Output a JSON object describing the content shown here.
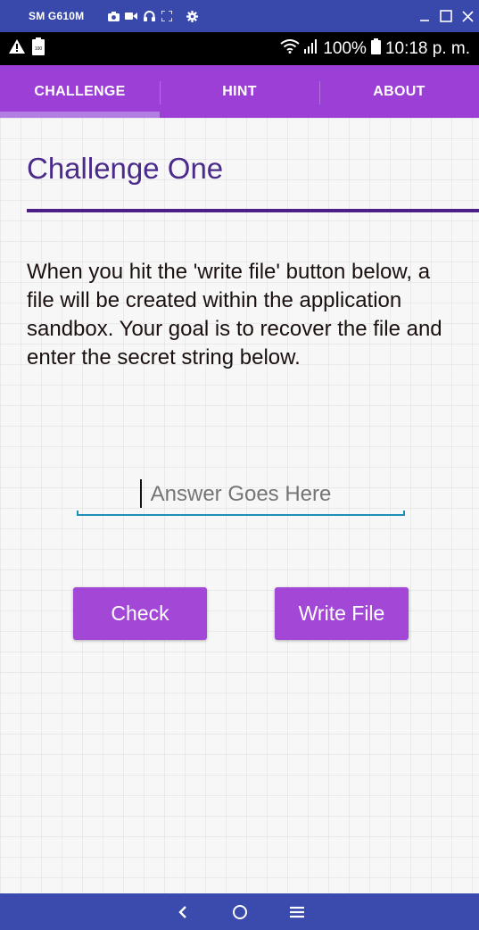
{
  "window": {
    "title": "SM G610M",
    "tools": [
      "camera-icon",
      "video-icon",
      "headset-icon",
      "fullscreen-icon",
      "settings-icon"
    ],
    "controls": [
      "minimize-icon",
      "maximize-icon",
      "close-icon"
    ]
  },
  "status_bar": {
    "left_icons": [
      "warning-icon",
      "battery-100-icon"
    ],
    "battery": "100%",
    "time": "10:18 p. m."
  },
  "tabs": [
    {
      "label": "CHALLENGE",
      "active": true
    },
    {
      "label": "HINT",
      "active": false
    },
    {
      "label": "ABOUT",
      "active": false
    }
  ],
  "main": {
    "title": "Challenge One",
    "description": "When you hit the 'write file' button below, a file will be created within the application sandbox. Your goal is to recover the file and enter the secret string below.",
    "answer_placeholder": "Answer Goes Here",
    "answer_value": "",
    "check_label": "Check",
    "write_file_label": "Write File"
  },
  "nav_bar": {
    "buttons": [
      "back-icon",
      "home-icon",
      "menu-icon"
    ]
  },
  "colors": {
    "window_bar": "#3949ab",
    "tab_bar": "#9c3fd6",
    "title": "#4a2a8a",
    "rule": "#4a1f86",
    "button": "#a347d6",
    "input_underline": "#1f8fb8",
    "nav_bar": "#3b4aad"
  }
}
